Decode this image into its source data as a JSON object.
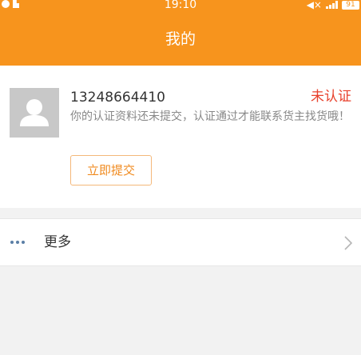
{
  "status_bar": {
    "time": "19:10",
    "battery": "91"
  },
  "header": {
    "title": "我的"
  },
  "profile": {
    "phone": "13248664410",
    "status": "未认证",
    "notice": "你的认证资料还未提交，认证通过才能联系货主找货哦！",
    "submit_label": "立即提交"
  },
  "more": {
    "label": "更多"
  },
  "colors": {
    "accent": "#f7941d",
    "status_red": "#e8412c",
    "background": "#f2f2f2"
  },
  "icons": {
    "avatar": "person-icon",
    "more": "ellipsis-icon",
    "arrow": "chevron-right-icon"
  }
}
